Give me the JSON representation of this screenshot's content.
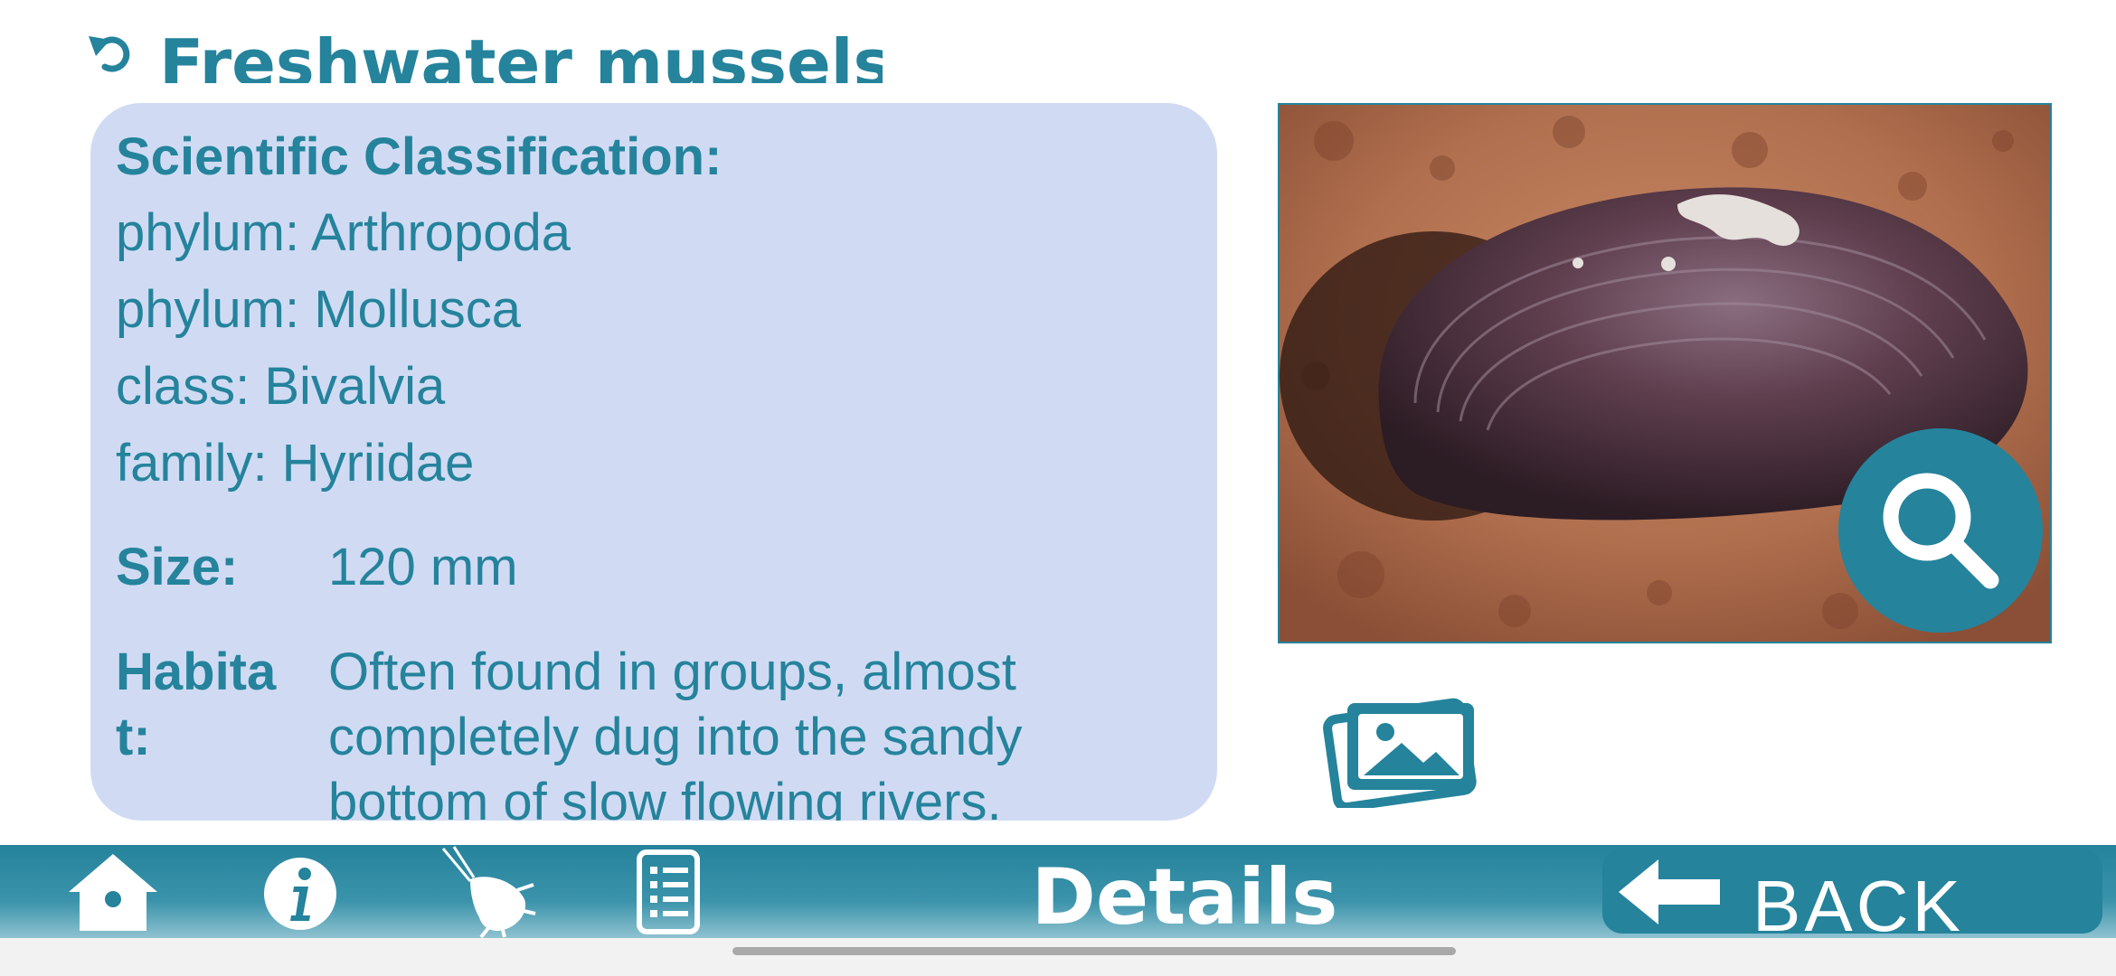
{
  "header": {
    "title": "Freshwater mussels"
  },
  "info": {
    "classification_heading": "Scientific Classification:",
    "classification": [
      "phylum: Arthropoda",
      "phylum: Mollusca",
      "class: Bivalvia",
      "family: Hyriidae"
    ],
    "size_label": "Size:",
    "size_value": "120 mm",
    "habitat_label": "Habitat:",
    "habitat_value": "Often found in groups, almost completely dug into the sandy bottom of slow flowing rivers."
  },
  "bottom_bar": {
    "title": "Details",
    "back_label": "BACK"
  },
  "icons": {
    "undo": "undo-icon",
    "zoom": "magnifier-icon",
    "gallery": "gallery-icon",
    "home": "home-icon",
    "info": "info-icon",
    "creature": "creature-icon",
    "list": "list-icon",
    "back": "back-arrow-icon"
  },
  "colors": {
    "accent": "#25839c",
    "card_bg": "#d0dbf3",
    "bar_text": "#ffffff"
  }
}
